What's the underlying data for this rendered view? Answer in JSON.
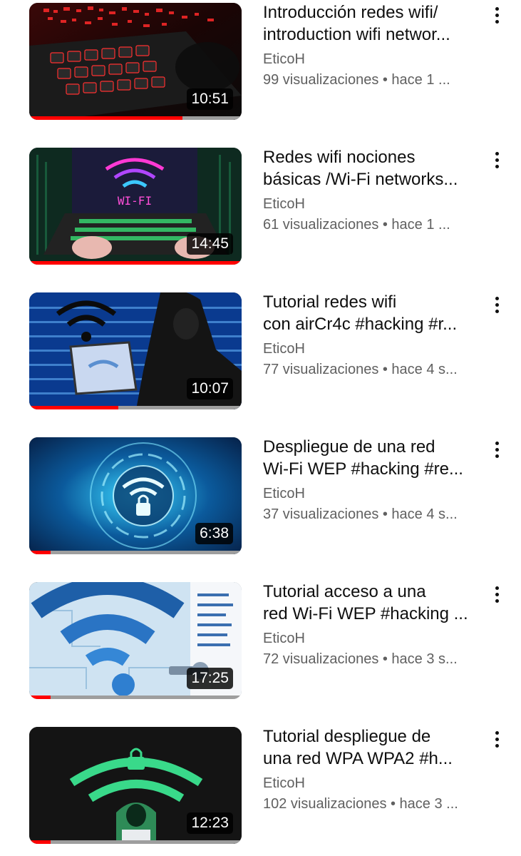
{
  "videos": [
    {
      "title_line1": "Introducción redes wifi/",
      "title_line2": "introduction wifi networ...",
      "channel": "EticoH",
      "meta": "99 visualizaciones • hace 1 ...",
      "duration": "10:51",
      "progress": 0.72,
      "thumbnail_icon": "red-keyboard-laptop"
    },
    {
      "title_line1": "Redes wifi nociones",
      "title_line2": "básicas /Wi-Fi networks...",
      "channel": "EticoH",
      "meta": "61 visualizaciones • hace 1 ...",
      "duration": "14:45",
      "progress": 1.0,
      "thumbnail_icon": "neon-wifi-laptop"
    },
    {
      "title_line1": "Tutorial redes wifi",
      "title_line2": "con airCr4c #hacking #r...",
      "channel": "EticoH",
      "meta": "77 visualizaciones • hace 4 s...",
      "duration": "10:07",
      "progress": 0.42,
      "thumbnail_icon": "hooded-hacker-wifi"
    },
    {
      "title_line1": "Despliegue de una red",
      "title_line2": "Wi-Fi WEP #hacking #re...",
      "channel": "EticoH",
      "meta": "37 visualizaciones • hace 4 s...",
      "duration": "6:38",
      "progress": 0.1,
      "thumbnail_icon": "wifi-lock-circle"
    },
    {
      "title_line1": "Tutorial acceso a una",
      "title_line2": "red Wi-Fi WEP #hacking ...",
      "channel": "EticoH",
      "meta": "72 visualizaciones • hace 3 s...",
      "duration": "17:25",
      "progress": 0.1,
      "thumbnail_icon": "wifi-key-unlock"
    },
    {
      "title_line1": "Tutorial despliegue de",
      "title_line2": "una red WPA  WPA2 #h...",
      "channel": "EticoH",
      "meta": "102 visualizaciones • hace 3 ...",
      "duration": "12:23",
      "progress": 0.1,
      "thumbnail_icon": "green-wifi-hacker"
    }
  ],
  "colors": {
    "accent": "#ff0000",
    "text": "#0f0f0f",
    "secondary": "#606060",
    "track": "#9e9e9e"
  }
}
